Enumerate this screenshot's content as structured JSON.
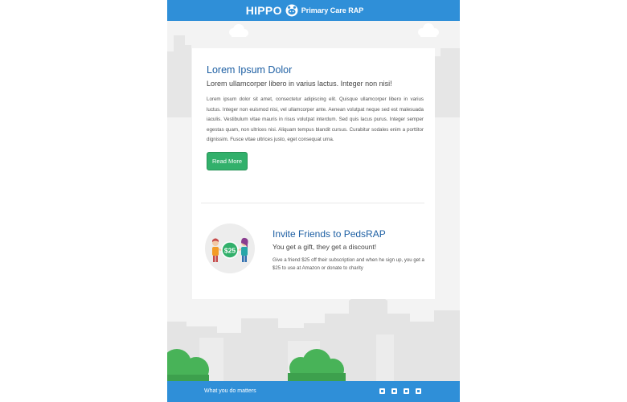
{
  "header": {
    "brand": "HIPPO",
    "product": "Primary Care RAP",
    "logo_icon": "hippo-face-icon",
    "bg_color": "#2f8fd8"
  },
  "article": {
    "title": "Lorem Ipsum Dolor",
    "subtitle": "Lorem ullamcorper libero in varius lactus. Integer non nisi!",
    "body": "Lorem ipsum dolor sit amet, consectetur adipiscing elit. Quisque ullamcorper libero in varius luctus. Integer non euismod nisi, vel ullamcorper ante. Aenean volutpat neque sed est malesuada iaculis. Vestibulum vitae mauris in risus volutpat interdum. Sed quis lacus purus. Integer semper egestas quam, non ultrices nisi. Aliquam tempus blandit cursus. Curabitur sodales enim a porttitor dignissim. Fusce vitae ultrices justo, eget consequat urna.",
    "button_label": "Read More",
    "button_color": "#32b06b"
  },
  "invite": {
    "badge_amount": "$25",
    "title": "Invite Friends to PedsRAP",
    "subtitle": "You get a gift, they get a discount!",
    "body": "Give a friend $25 off their subscription and when he sign up, you get a $25 to use at Amazon or donate to charity"
  },
  "footer": {
    "tagline": "What you do matters",
    "social_icons": [
      "facebook-icon",
      "twitter-icon",
      "rss-icon",
      "linkedin-icon"
    ]
  },
  "colors": {
    "title_blue": "#1d5fa3",
    "accent_green": "#32b06b",
    "background_gray": "#f3f3f3"
  }
}
